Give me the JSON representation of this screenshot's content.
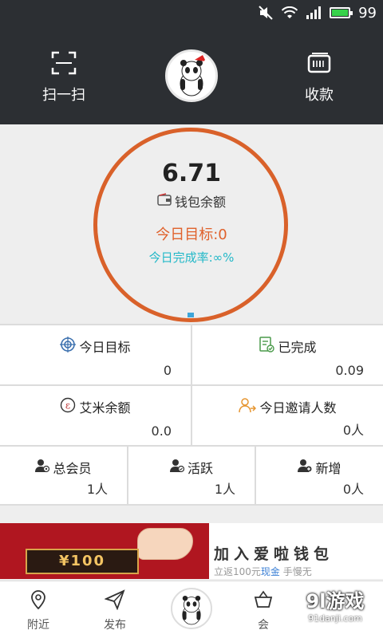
{
  "status_bar": {
    "battery": "99"
  },
  "header": {
    "scan_label": "扫一扫",
    "receive_label": "收款"
  },
  "wallet": {
    "balance": "6.71",
    "balance_label": "钱包余额",
    "today_target": "今日目标:0",
    "today_rate": "今日完成率:∞%"
  },
  "stats": {
    "today_target": {
      "label": "今日目标",
      "value": "0"
    },
    "completed": {
      "label": "已完成",
      "value": "0.09"
    },
    "aimi_balance": {
      "label": "艾米余额",
      "value": "0.0"
    },
    "invites_today": {
      "label": "今日邀请人数",
      "value": "0人"
    },
    "total_members": {
      "label": "总会员",
      "value": "1人"
    },
    "active": {
      "label": "活跃",
      "value": "1人"
    },
    "new": {
      "label": "新增",
      "value": "0人"
    }
  },
  "banner": {
    "cash": "¥100",
    "headline": "加入爱啦钱包",
    "sub_prefix": "立返100元",
    "sub_cash": "现金",
    "sub_suffix": "手慢无"
  },
  "bottom_nav": {
    "nearby": "附近",
    "publish": "发布",
    "member": "会"
  },
  "watermark": {
    "main": "9l游戏",
    "sub": "91danji.com"
  },
  "colors": {
    "accent": "#d9612a",
    "rate": "#22b8c8",
    "header_bg": "#2c2f33"
  }
}
